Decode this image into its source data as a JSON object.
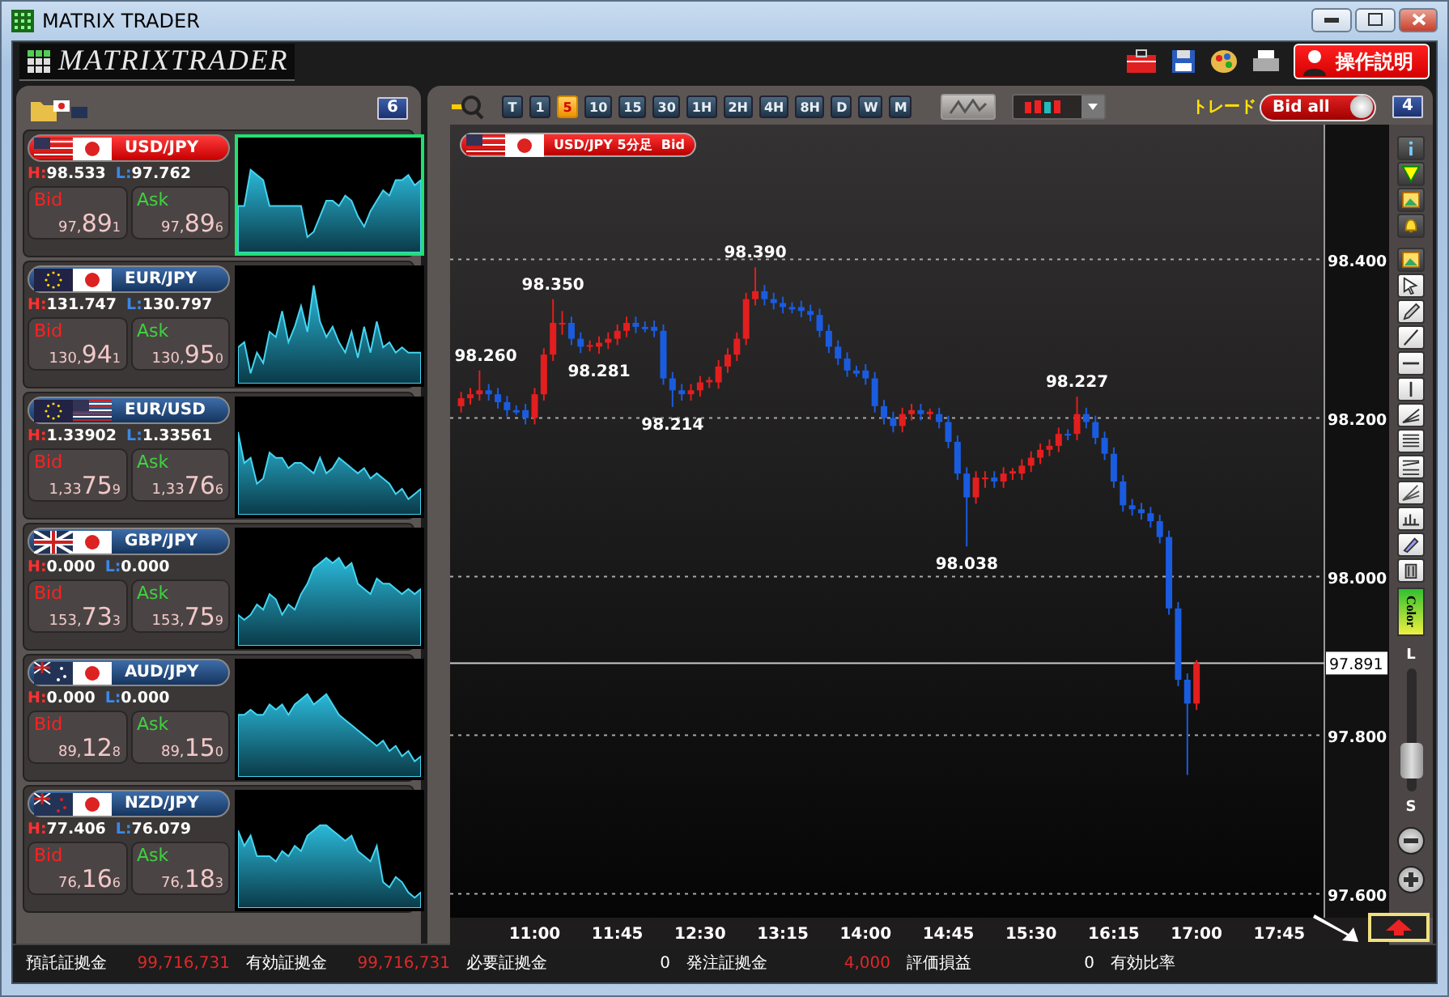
{
  "window": {
    "title": "MATRIX TRADER"
  },
  "header": {
    "logo": "MATRIXTRADER",
    "help_button": "操作説明"
  },
  "rates_panel": {
    "count": "6",
    "cards": [
      {
        "pair": "USD/JPY",
        "flags": [
          {
            "kind": "us"
          },
          {
            "kind": "jp"
          }
        ],
        "selected": true,
        "high_label": "H:",
        "high": "98.533",
        "low_label": "L:",
        "low": "97.762",
        "bid_label": "Bid",
        "bid": [
          "97,",
          "89",
          "1"
        ],
        "ask_label": "Ask",
        "ask": [
          "97,",
          "89",
          "6"
        ]
      },
      {
        "pair": "EUR/JPY",
        "flags": [
          {
            "kind": "eu"
          },
          {
            "kind": "jp"
          }
        ],
        "selected": false,
        "high_label": "H:",
        "high": "131.747",
        "low_label": "L:",
        "low": "130.797",
        "bid_label": "Bid",
        "bid": [
          "130,",
          "94",
          "1"
        ],
        "ask_label": "Ask",
        "ask": [
          "130,",
          "95",
          "0"
        ]
      },
      {
        "pair": "EUR/USD",
        "flags": [
          {
            "kind": "eu"
          },
          {
            "kind": "us"
          }
        ],
        "selected": false,
        "high_label": "H:",
        "high": "1.33902",
        "low_label": "L:",
        "low": "1.33561",
        "bid_label": "Bid",
        "bid": [
          "1,33",
          "75",
          "9"
        ],
        "ask_label": "Ask",
        "ask": [
          "1,33",
          "76",
          "6"
        ]
      },
      {
        "pair": "GBP/JPY",
        "flags": [
          {
            "kind": "gb"
          },
          {
            "kind": "jp"
          }
        ],
        "selected": false,
        "high_label": "H:",
        "high": "0.000",
        "low_label": "L:",
        "low": "0.000",
        "bid_label": "Bid",
        "bid": [
          "153,",
          "73",
          "3"
        ],
        "ask_label": "Ask",
        "ask": [
          "153,",
          "75",
          "9"
        ]
      },
      {
        "pair": "AUD/JPY",
        "flags": [
          {
            "kind": "au"
          },
          {
            "kind": "jp"
          }
        ],
        "selected": false,
        "high_label": "H:",
        "high": "0.000",
        "low_label": "L:",
        "low": "0.000",
        "bid_label": "Bid",
        "bid": [
          "89,",
          "12",
          "8"
        ],
        "ask_label": "Ask",
        "ask": [
          "89,",
          "15",
          "0"
        ]
      },
      {
        "pair": "NZD/JPY",
        "flags": [
          {
            "kind": "nz"
          },
          {
            "kind": "jp"
          }
        ],
        "selected": false,
        "high_label": "H:",
        "high": "77.406",
        "low_label": "L:",
        "low": "76.079",
        "bid_label": "Bid",
        "bid": [
          "76,",
          "16",
          "6"
        ],
        "ask_label": "Ask",
        "ask": [
          "76,",
          "18",
          "3"
        ]
      }
    ]
  },
  "chart_panel": {
    "timeframes": [
      {
        "label": "T",
        "selected": false
      },
      {
        "label": "1",
        "selected": false
      },
      {
        "label": "5",
        "selected": true
      },
      {
        "label": "10",
        "selected": false
      },
      {
        "label": "15",
        "selected": false
      },
      {
        "label": "30",
        "selected": false
      },
      {
        "label": "1H",
        "selected": false
      },
      {
        "label": "2H",
        "selected": false
      },
      {
        "label": "4H",
        "selected": false
      },
      {
        "label": "8H",
        "selected": false
      },
      {
        "label": "D",
        "selected": false
      },
      {
        "label": "W",
        "selected": false
      },
      {
        "label": "M",
        "selected": false
      }
    ],
    "trade_label": "トレード",
    "trade_toggle": {
      "label": "Bid all",
      "on": true
    },
    "count": "4",
    "chart": {
      "flags": [
        {
          "kind": "us"
        },
        {
          "kind": "jp"
        }
      ],
      "title": "USD/JPY 5分足",
      "side": "Bid",
      "chart_data": {
        "type": "candlestick",
        "grid": true,
        "ylim": [
          97.57,
          98.57
        ],
        "categories": [
          null,
          null,
          null,
          null,
          null,
          null,
          null,
          null,
          "11:00",
          null,
          null,
          null,
          null,
          null,
          null,
          null,
          null,
          "11:45",
          null,
          null,
          null,
          null,
          null,
          null,
          null,
          null,
          "12:30",
          null,
          null,
          null,
          null,
          null,
          null,
          null,
          null,
          "13:15",
          null,
          null,
          null,
          null,
          null,
          null,
          null,
          null,
          "14:00",
          null,
          null,
          null,
          null,
          null,
          null,
          null,
          null,
          "14:45",
          null,
          null,
          null,
          null,
          null,
          null,
          null,
          null,
          "15:30",
          null,
          null,
          null,
          null,
          null,
          null,
          null,
          null,
          "16:15",
          null,
          null,
          null,
          null,
          null,
          null,
          null,
          null,
          "17:00",
          null,
          null,
          null,
          null,
          null,
          null,
          null,
          null,
          "17:45"
        ],
        "yticks": [
          {
            "value": 98.4,
            "label": "98.400"
          },
          {
            "value": 98.2,
            "label": "98.200"
          },
          {
            "value": 98.0,
            "label": "98.000"
          },
          {
            "value": 97.8,
            "label": "97.800"
          },
          {
            "value": 97.6,
            "label": "97.600"
          }
        ],
        "ref_lines": [
          {
            "axis": "y",
            "value": 97.891,
            "label": "97.891"
          }
        ],
        "annotations": [
          {
            "y": 98.26,
            "text": "98.260"
          },
          {
            "y": 98.35,
            "text": "98.350"
          },
          {
            "y": 98.281,
            "text": "98.281"
          },
          {
            "y": 98.214,
            "text": "98.214"
          },
          {
            "y": 98.39,
            "text": "98.390"
          },
          {
            "y": 98.038,
            "text": "98.038"
          },
          {
            "y": 98.227,
            "text": "98.227"
          }
        ],
        "ohlc": [
          [
            98.215,
            98.233,
            98.207,
            98.225
          ],
          [
            98.225,
            98.238,
            98.217,
            98.23
          ],
          [
            98.23,
            98.26,
            98.222,
            98.235
          ],
          [
            98.235,
            98.243,
            98.222,
            98.23
          ],
          [
            98.23,
            98.238,
            98.212,
            98.22
          ],
          [
            98.22,
            98.228,
            98.202,
            98.21
          ],
          [
            98.21,
            98.216,
            98.204,
            98.207
          ],
          [
            98.21,
            98.218,
            98.192,
            98.2
          ],
          [
            98.2,
            98.238,
            98.192,
            98.23
          ],
          [
            98.23,
            98.288,
            98.222,
            98.28
          ],
          [
            98.28,
            98.35,
            98.272,
            98.32
          ],
          [
            98.32,
            98.335,
            98.305,
            98.32
          ],
          [
            98.32,
            98.328,
            98.292,
            98.3
          ],
          [
            98.3,
            98.308,
            98.282,
            98.29
          ],
          [
            98.29,
            98.298,
            98.284,
            98.292
          ],
          [
            98.29,
            98.303,
            98.281,
            98.295
          ],
          [
            98.295,
            98.308,
            98.287,
            98.3
          ],
          [
            98.3,
            98.318,
            98.292,
            98.31
          ],
          [
            98.31,
            98.328,
            98.302,
            98.32
          ],
          [
            98.32,
            98.328,
            98.307,
            98.315
          ],
          [
            98.315,
            98.322,
            98.308,
            98.312
          ],
          [
            98.315,
            98.323,
            98.302,
            98.31
          ],
          [
            98.31,
            98.318,
            98.242,
            98.25
          ],
          [
            98.25,
            98.258,
            98.214,
            98.235
          ],
          [
            98.235,
            98.243,
            98.222,
            98.23
          ],
          [
            98.23,
            98.243,
            98.222,
            98.235
          ],
          [
            98.235,
            98.253,
            98.227,
            98.245
          ],
          [
            98.245,
            98.252,
            98.238,
            98.248
          ],
          [
            98.245,
            98.273,
            98.237,
            98.265
          ],
          [
            98.265,
            98.288,
            98.257,
            98.28
          ],
          [
            98.28,
            98.308,
            98.272,
            98.3
          ],
          [
            98.3,
            98.358,
            98.292,
            98.35
          ],
          [
            98.35,
            98.39,
            98.342,
            98.36
          ],
          [
            98.36,
            98.368,
            98.342,
            98.35
          ],
          [
            98.35,
            98.358,
            98.337,
            98.345
          ],
          [
            98.345,
            98.353,
            98.332,
            98.34
          ],
          [
            98.34,
            98.346,
            98.332,
            98.337
          ],
          [
            98.34,
            98.348,
            98.327,
            98.335
          ],
          [
            98.335,
            98.343,
            98.322,
            98.33
          ],
          [
            98.33,
            98.338,
            98.302,
            98.31
          ],
          [
            98.31,
            98.318,
            98.282,
            98.29
          ],
          [
            98.29,
            98.298,
            98.267,
            98.275
          ],
          [
            98.275,
            98.283,
            98.252,
            98.26
          ],
          [
            98.26,
            98.266,
            98.252,
            98.256
          ],
          [
            98.26,
            98.268,
            98.242,
            98.25
          ],
          [
            98.25,
            98.258,
            98.207,
            98.215
          ],
          [
            98.215,
            98.223,
            98.192,
            98.2
          ],
          [
            98.2,
            98.208,
            98.182,
            98.19
          ],
          [
            98.19,
            98.213,
            98.182,
            98.205
          ],
          [
            98.205,
            98.218,
            98.197,
            98.21
          ],
          [
            98.21,
            98.218,
            98.197,
            98.205
          ],
          [
            98.205,
            98.212,
            98.198,
            98.208
          ],
          [
            98.205,
            98.213,
            98.187,
            98.195
          ],
          [
            98.195,
            98.203,
            98.162,
            98.17
          ],
          [
            98.17,
            98.178,
            98.122,
            98.13
          ],
          [
            98.13,
            98.138,
            98.038,
            98.1
          ],
          [
            98.1,
            98.133,
            98.092,
            98.125
          ],
          [
            98.125,
            98.133,
            98.112,
            98.125
          ],
          [
            98.125,
            98.133,
            98.112,
            98.12
          ],
          [
            98.12,
            98.138,
            98.112,
            98.13
          ],
          [
            98.13,
            98.137,
            98.122,
            98.133
          ],
          [
            98.13,
            98.148,
            98.122,
            98.14
          ],
          [
            98.14,
            98.158,
            98.132,
            98.15
          ],
          [
            98.15,
            98.168,
            98.142,
            98.16
          ],
          [
            98.16,
            98.173,
            98.152,
            98.165
          ],
          [
            98.165,
            98.188,
            98.157,
            98.18
          ],
          [
            98.18,
            98.186,
            98.172,
            98.178
          ],
          [
            98.18,
            98.227,
            98.172,
            98.205
          ],
          [
            98.205,
            98.213,
            98.187,
            98.195
          ],
          [
            98.195,
            98.203,
            98.167,
            98.175
          ],
          [
            98.175,
            98.183,
            98.147,
            98.155
          ],
          [
            98.155,
            98.163,
            98.112,
            98.12
          ],
          [
            98.12,
            98.128,
            98.082,
            98.09
          ],
          [
            98.09,
            98.098,
            98.077,
            98.085
          ],
          [
            98.085,
            98.093,
            98.072,
            98.08
          ],
          [
            98.08,
            98.088,
            98.062,
            98.07
          ],
          [
            98.07,
            98.078,
            98.042,
            98.05
          ],
          [
            98.05,
            98.058,
            97.952,
            97.96
          ],
          [
            97.96,
            97.968,
            97.862,
            97.87
          ],
          [
            97.87,
            97.878,
            97.75,
            97.84
          ],
          [
            97.84,
            97.895,
            97.832,
            97.891
          ],
          null,
          null,
          null,
          null,
          null,
          null,
          null,
          null,
          null
        ]
      }
    },
    "zoom": {
      "large_label": "L",
      "small_label": "S",
      "level": 0.15
    },
    "color_button": "Color"
  },
  "status_bar": [
    {
      "label": "預託証拠金",
      "value": "99,716,731",
      "color": "#e02828"
    },
    {
      "label": "有効証拠金",
      "value": "99,716,731",
      "color": "#e02828"
    },
    {
      "label": "必要証拠金",
      "value": "0",
      "color": "#ffffff"
    },
    {
      "label": "発注証拠金",
      "value": "4,000",
      "color": "#e02828"
    },
    {
      "label": "評価損益",
      "value": "0",
      "color": "#ffffff"
    },
    {
      "label": "有効比率"
    }
  ]
}
